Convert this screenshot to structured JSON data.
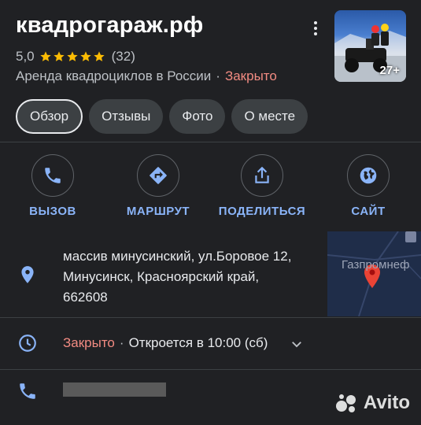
{
  "place": {
    "title": "квадрогараж.рф",
    "rating": "5,0",
    "reviews_count": "(32)",
    "stars": 5,
    "category": "Аренда квадроциклов в России",
    "separator": "·",
    "status": "Закрыто",
    "photo_count": "27+"
  },
  "tabs": [
    {
      "label": "Обзор"
    },
    {
      "label": "Отзывы"
    },
    {
      "label": "Фото"
    },
    {
      "label": "О месте"
    }
  ],
  "actions": {
    "call": "ВЫЗОВ",
    "route": "МАРШРУТ",
    "share": "ПОДЕЛИТЬСЯ",
    "website": "САЙТ"
  },
  "address": {
    "line1": "массив минусинский, ул.Боровое 12,",
    "line2": "Минусинск, Красноярский край,",
    "line3": "662608"
  },
  "map": {
    "label": "Газпромнеф"
  },
  "hours": {
    "status": "Закрыто",
    "separator": "·",
    "next": "Откроется в 10:00 (сб)"
  },
  "watermark": "Avito",
  "colors": {
    "background": "#202124",
    "accent": "#8ab4f8",
    "closed": "#f28b82",
    "star": "#fbbc04",
    "pin": "#ea4335"
  }
}
